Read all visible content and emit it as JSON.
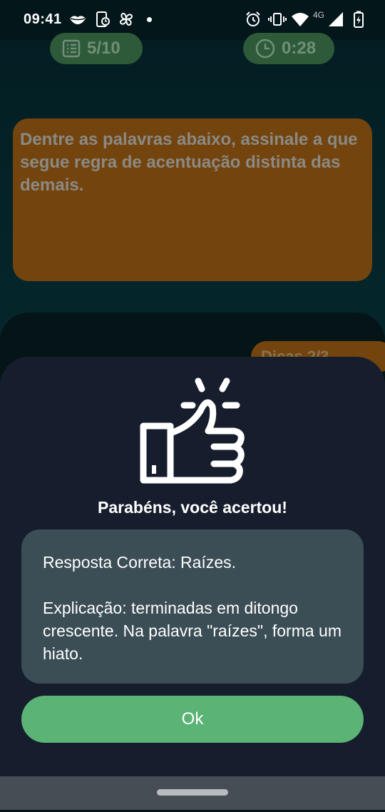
{
  "status_bar": {
    "time": "09:41",
    "network": "4G",
    "icons": [
      "lips-icon",
      "phone-clock-icon",
      "pinwheel-icon",
      "notification-dot",
      "alarm-icon",
      "vibrate-icon",
      "wifi-icon",
      "signal-icon",
      "battery-charging-icon"
    ]
  },
  "header": {
    "progress_label": "5/10",
    "timer_label": "0:28"
  },
  "question": {
    "text": "Dentre as palavras abaixo, assinale a que  segue regra de acentuação distinta das  demais."
  },
  "help": {
    "label": "Dicas 2/3"
  },
  "result_sheet": {
    "icon": "thumbs-up-icon",
    "title": "Parabéns, você acertou!",
    "answer_line": "Resposta Correta: Raízes.",
    "explanation": "Explicação: terminadas em ditongo crescente. Na palavra \"raízes\", forma um hiato.",
    "ok_label": "Ok"
  },
  "colors": {
    "accent_green": "#5bb375",
    "question_card": "#74440f",
    "sheet_bg": "#161d2d",
    "answer_box": "#3b4d55"
  }
}
